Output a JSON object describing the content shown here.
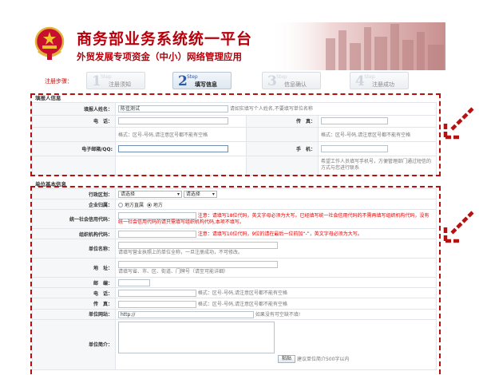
{
  "header": {
    "title": "商务部业务系统统一平台",
    "subtitle": "外贸发展专项资金（中小）网络管理应用"
  },
  "steps": {
    "label": "注册步骤：",
    "step_word": "Step",
    "items": [
      {
        "num": "1",
        "label": "注册须知"
      },
      {
        "num": "2",
        "label": "填写信息"
      },
      {
        "num": "3",
        "label": "信息确认"
      },
      {
        "num": "4",
        "label": "注册成功"
      }
    ]
  },
  "contact": {
    "section_title": "填报人信息",
    "name_label": "填报人姓名：",
    "name_value": "陈佳测试",
    "name_hint": "请如实填写个人姓名,不要填写单位名称",
    "phone_label": "电　话：",
    "fax_label": "传　真：",
    "phone_hint": "格式：区号-号码,请注意区号都不能有空格",
    "fax_hint": "格式：区号-号码,请注意区号都不能有空格",
    "email_label": "电子邮箱/QQ:",
    "mobile_label": "手　机：",
    "mobile_hint": "希望工作人员填写手机号，方便管理部门通过短信的方式与您进行联系"
  },
  "unit": {
    "section_title": "单位基本信息",
    "region_label": "行政区划：",
    "region_select_1": "请选择",
    "region_select_2": "请选择",
    "belong_label": "企业归属：",
    "belong_opt_1": "地方直属",
    "belong_opt_2": "地方",
    "credit_label": "统一社会信用代码：",
    "credit_note": "注意：请填写18位代码，英文字母必须为大写。已经填写统一社会信用代码的不需再填写组织机构代码，没有统一社会信用代码的请只需填写组织机构代码,本项不填写。",
    "org_label": "组织机构代码：",
    "org_note": "注意：请填写10位代码，9位的请在最后一位前加“-”，英文字母必须为大写。",
    "unit_name_label": "单位名称：",
    "unit_name_hint": "请填写营业执照上的单位全称，一旦注册成功，不可修改。",
    "address_label": "地　址：",
    "address_hint": "请填写省、市、区、街道、门牌号（请至可能详细）",
    "postcode_label": "邮　编：",
    "tel_label": "电　话：",
    "tel_hint": "格式：区号-号码,请注意区号都不能有空格",
    "fax_label": "传　真：",
    "fax_hint": "格式：区号-号码,请注意区号都不能有空格",
    "website_label": "单位网站：",
    "website_value": "http://",
    "website_hint": "如果没有可空缺不填!",
    "intro_label": "单位简介：",
    "paste_button": "粘贴",
    "intro_hint": "建议单位简介500字以内"
  },
  "colors": {
    "brand_red": "#b8000b",
    "annotation_red": "#b80f0f",
    "step_blue": "#2b5aa8"
  }
}
